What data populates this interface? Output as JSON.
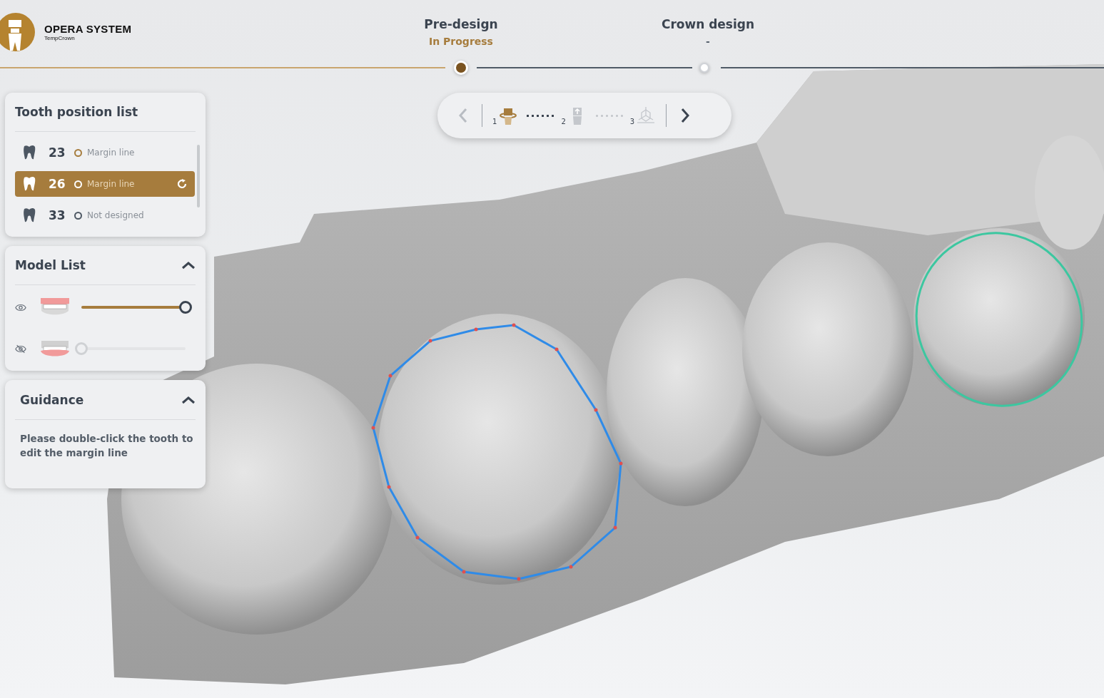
{
  "logo": {
    "title": "OPERA SYSTEM",
    "subtitle": "TempCrown"
  },
  "steps": [
    {
      "label": "Pre-design",
      "status": "In Progress",
      "selected": true
    },
    {
      "label": "Crown design",
      "status": "-",
      "selected": false
    }
  ],
  "toolbar": {
    "nav": [
      {
        "kind": "prev",
        "disabled": true
      },
      {
        "kind": "next",
        "disabled": false
      }
    ],
    "tools": [
      {
        "number": "1",
        "kind": "crown",
        "selected": true
      },
      {
        "number": "2",
        "kind": "insertion",
        "selected": false
      },
      {
        "number": "3",
        "kind": "axis",
        "selected": false
      }
    ]
  },
  "tooth_list": {
    "title": "Tooth position list",
    "items": [
      {
        "number": "23",
        "status": "Margin line",
        "designed": true,
        "selected": false
      },
      {
        "number": "26",
        "status": "Margin line",
        "designed": true,
        "selected": true
      },
      {
        "number": "33",
        "status": "Not designed",
        "designed": false,
        "selected": false
      }
    ]
  },
  "model_list": {
    "title": "Model List",
    "expanded": true,
    "models": [
      {
        "kind": "upper",
        "visible": true,
        "level": 1
      },
      {
        "kind": "lower",
        "visible": false,
        "level": 0
      }
    ]
  },
  "guidance": {
    "title": "Guidance",
    "expanded": true,
    "text": "Please double-click the tooth to edit the margin line"
  }
}
